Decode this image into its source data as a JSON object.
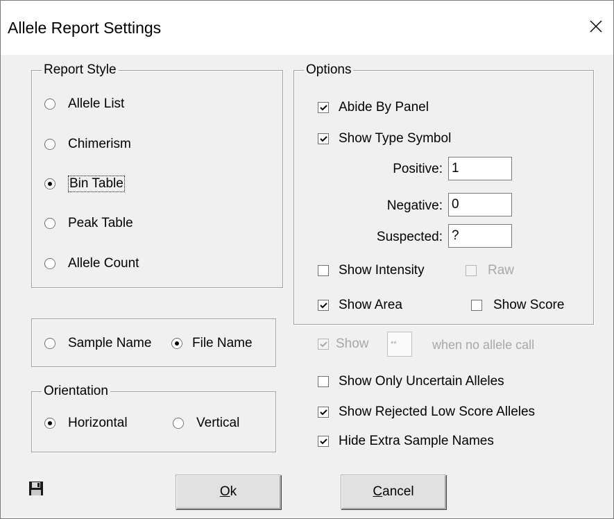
{
  "window": {
    "title": "Allele Report Settings",
    "close_icon": "close-icon"
  },
  "report_style": {
    "label": "Report Style",
    "options": [
      {
        "label": "Allele List",
        "selected": false
      },
      {
        "label": "Chimerism",
        "selected": false
      },
      {
        "label": "Bin Table",
        "selected": true
      },
      {
        "label": "Peak Table",
        "selected": false
      },
      {
        "label": "Allele Count",
        "selected": false
      }
    ]
  },
  "name_source": {
    "options": [
      {
        "label": "Sample Name",
        "selected": false
      },
      {
        "label": "File Name",
        "selected": true
      }
    ]
  },
  "orientation": {
    "label": "Orientation",
    "options": [
      {
        "label": "Horizontal",
        "selected": true
      },
      {
        "label": "Vertical",
        "selected": false
      }
    ]
  },
  "options": {
    "label": "Options",
    "abide_by_panel": {
      "label": "Abide By Panel",
      "checked": true
    },
    "show_type_symbol": {
      "label": "Show Type Symbol",
      "checked": true
    },
    "positive": {
      "label": "Positive:",
      "value": "1"
    },
    "negative": {
      "label": "Negative:",
      "value": "0"
    },
    "suspected": {
      "label": "Suspected:",
      "value": "?"
    },
    "show_intensity": {
      "label": "Show Intensity",
      "checked": false
    },
    "raw": {
      "label": "Raw",
      "checked": false,
      "disabled": true
    },
    "show_area": {
      "label": "Show Area",
      "checked": true
    },
    "show_score": {
      "label": "Show Score",
      "checked": false
    }
  },
  "extra": {
    "show_placeholder": {
      "label": "Show",
      "value": "**",
      "suffix": "when no allele call",
      "checked": true,
      "disabled": true
    },
    "show_only_uncertain": {
      "label": "Show Only Uncertain Alleles",
      "checked": false
    },
    "show_rejected_low_score": {
      "label": "Show Rejected Low Score Alleles",
      "checked": true
    },
    "hide_extra_sample_names": {
      "label": "Hide Extra Sample Names",
      "checked": true
    }
  },
  "buttons": {
    "ok": {
      "mnemonic": "O",
      "rest": "k"
    },
    "cancel": {
      "mnemonic": "C",
      "rest": "ancel"
    }
  },
  "save_icon": "floppy-disk-icon"
}
